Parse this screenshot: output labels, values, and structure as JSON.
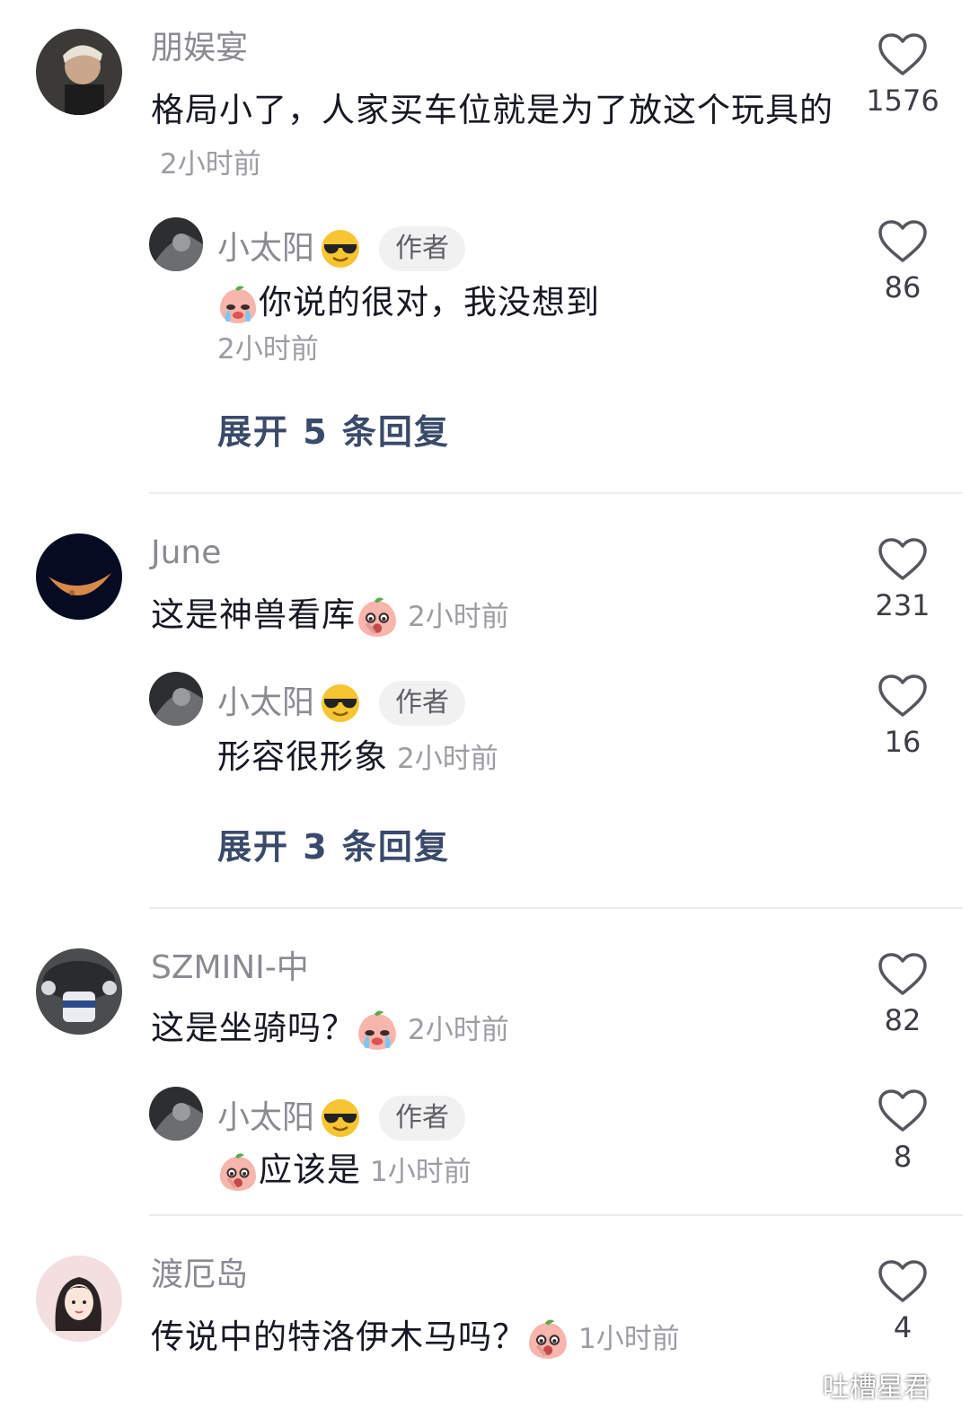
{
  "comments": [
    {
      "username": "朋娱宴",
      "text": "格局小了，人家买车位就是为了放这个玩具的",
      "time": "2小时前",
      "likes": "1576",
      "reply": {
        "username": "小太阳",
        "badge": "作者",
        "text": "你说的很对，我没想到",
        "time": "2小时前",
        "likes": "86"
      },
      "expand_label": "展开 5 条回复"
    },
    {
      "username": "June",
      "text": "这是神兽看库",
      "time": "2小时前",
      "likes": "231",
      "reply": {
        "username": "小太阳",
        "badge": "作者",
        "text": "形容很形象",
        "time": "2小时前",
        "likes": "16"
      },
      "expand_label": "展开 3 条回复"
    },
    {
      "username": "SZMINI-中",
      "text": "这是坐骑吗？",
      "time": "2小时前",
      "likes": "82",
      "reply": {
        "username": "小太阳",
        "badge": "作者",
        "text": "应该是",
        "time": "1小时前",
        "likes": "8"
      }
    },
    {
      "username": "渡厄岛",
      "text": "传说中的特洛伊木马吗？",
      "time": "1小时前",
      "likes": "4"
    }
  ],
  "watermark": "吐槽星君",
  "colors": {
    "username": "#8a8b91",
    "text": "#161823",
    "time": "#9c9da2",
    "expand": "#3a4a6b",
    "badge_bg": "#f1f1f2"
  }
}
